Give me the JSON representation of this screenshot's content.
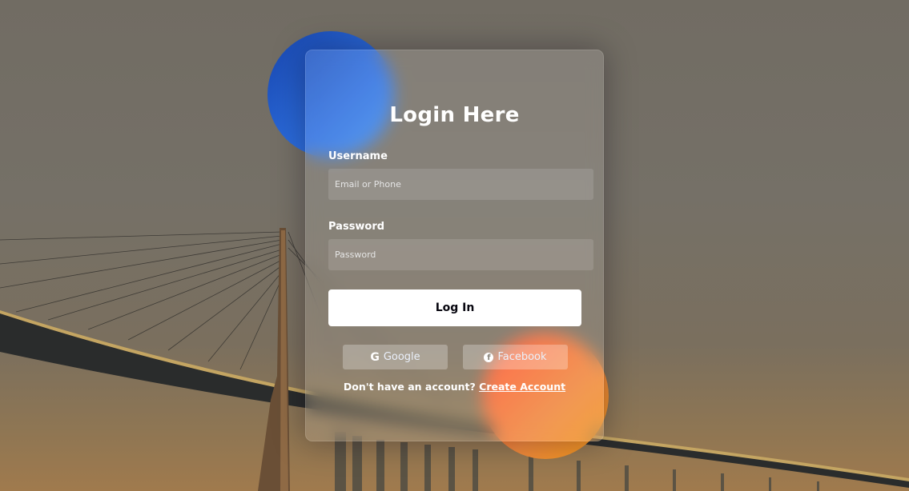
{
  "login": {
    "title": "Login Here",
    "username_label": "Username",
    "username_placeholder": "Email or Phone",
    "password_label": "Password",
    "password_placeholder": "Password",
    "login_button": "Log In",
    "google_label": "Google",
    "facebook_label": "Facebook",
    "signup_prompt": "Don't have an account?",
    "signup_link": "Create Account"
  },
  "icons": {
    "google": "google-icon",
    "facebook": "facebook-icon"
  },
  "colors": {
    "accent_blue": "#1845ad",
    "accent_orange": "#ff512f",
    "button_bg": "#ffffff",
    "button_text": "#080710"
  }
}
